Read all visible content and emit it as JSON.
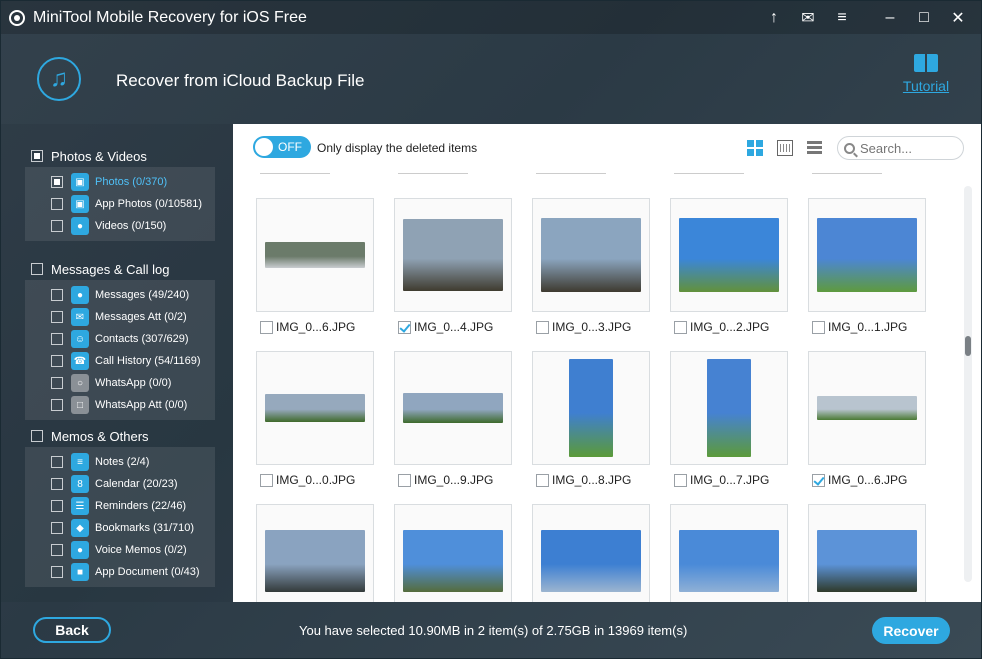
{
  "window": {
    "title": "MiniTool Mobile Recovery for iOS Free",
    "controls": [
      "upload-icon",
      "mail-icon",
      "menu-icon",
      "minimize-icon",
      "maximize-icon",
      "close-icon"
    ]
  },
  "header": {
    "title": "Recover from iCloud Backup File",
    "tutorial_label": "Tutorial"
  },
  "sidebar": {
    "groups": [
      {
        "label": "Photos & Videos",
        "items": [
          {
            "label": "Photos (0/370)",
            "icon": "photo-icon"
          },
          {
            "label": "App Photos (0/10581)",
            "icon": "app-photo-icon"
          },
          {
            "label": "Videos (0/150)",
            "icon": "video-icon"
          }
        ]
      },
      {
        "label": "Messages & Call log",
        "items": [
          {
            "label": "Messages (49/240)",
            "icon": "message-icon"
          },
          {
            "label": "Messages Att (0/2)",
            "icon": "message-attachment-icon"
          },
          {
            "label": "Contacts (307/629)",
            "icon": "contacts-icon"
          },
          {
            "label": "Call History (54/1169)",
            "icon": "call-history-icon"
          },
          {
            "label": "WhatsApp (0/0)",
            "icon": "whatsapp-icon"
          },
          {
            "label": "WhatsApp Att (0/0)",
            "icon": "whatsapp-attachment-icon"
          }
        ]
      },
      {
        "label": "Memos & Others",
        "items": [
          {
            "label": "Notes (2/4)",
            "icon": "notes-icon"
          },
          {
            "label": "Calendar (20/23)",
            "icon": "calendar-icon",
            "icon_text": "8"
          },
          {
            "label": "Reminders (22/46)",
            "icon": "reminders-icon"
          },
          {
            "label": "Bookmarks (31/710)",
            "icon": "bookmarks-icon"
          },
          {
            "label": "Voice Memos (0/2)",
            "icon": "voice-memo-icon"
          },
          {
            "label": "App Document (0/43)",
            "icon": "app-document-icon"
          }
        ]
      }
    ]
  },
  "toolbar": {
    "toggle_state": "OFF",
    "toggle_text": "Only display the deleted items",
    "search_placeholder": "Search..."
  },
  "thumbnails": [
    {
      "name": "IMG_0...6.JPG",
      "checked": false
    },
    {
      "name": "IMG_0...4.JPG",
      "checked": true
    },
    {
      "name": "IMG_0...3.JPG",
      "checked": false
    },
    {
      "name": "IMG_0...2.JPG",
      "checked": false
    },
    {
      "name": "IMG_0...1.JPG",
      "checked": false
    },
    {
      "name": "IMG_0...0.JPG",
      "checked": false
    },
    {
      "name": "IMG_0...9.JPG",
      "checked": false
    },
    {
      "name": "IMG_0...8.JPG",
      "checked": false
    },
    {
      "name": "IMG_0...7.JPG",
      "checked": false
    },
    {
      "name": "IMG_0...6.JPG",
      "checked": true
    },
    {
      "name": "",
      "checked": false
    },
    {
      "name": "",
      "checked": false
    },
    {
      "name": "",
      "checked": false
    },
    {
      "name": "",
      "checked": false
    },
    {
      "name": "",
      "checked": false
    }
  ],
  "footer": {
    "back_label": "Back",
    "status": "You have selected 10.90MB in 2 item(s) of 2.75GB in 13969 item(s)",
    "recover_label": "Recover"
  },
  "colors": {
    "accent": "#2ea8e0",
    "selected_text": "#4fc0f7"
  }
}
